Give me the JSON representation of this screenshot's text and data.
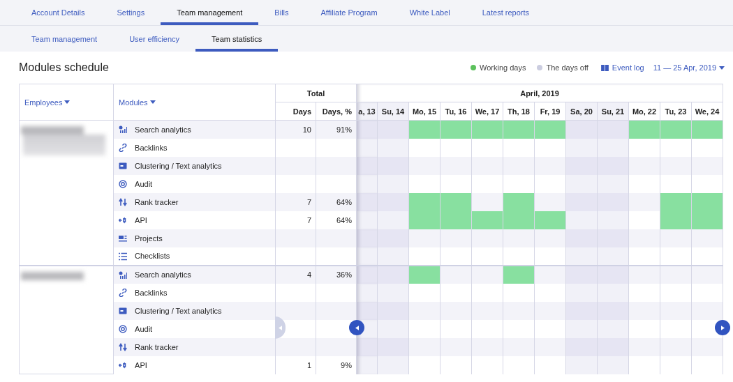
{
  "tabs": [
    {
      "label": "Account Details",
      "selected": false
    },
    {
      "label": "Settings",
      "selected": false
    },
    {
      "label": "Team management",
      "selected": true
    },
    {
      "label": "Bills",
      "selected": false
    },
    {
      "label": "Affiliate Program",
      "selected": false
    },
    {
      "label": "White Label",
      "selected": false
    },
    {
      "label": "Latest reports",
      "selected": false
    }
  ],
  "subtabs": [
    {
      "label": "Team management",
      "selected": false
    },
    {
      "label": "User efficiency",
      "selected": false
    },
    {
      "label": "Team statistics",
      "selected": true
    }
  ],
  "title": "Modules schedule",
  "legend": [
    {
      "label": "Working days",
      "color": "#5cc15c"
    },
    {
      "label": "The days off",
      "color": "#cbcde0"
    }
  ],
  "event_log": "Event log",
  "date_range": "11 — 25 Apr, 2019",
  "table": {
    "employees_header": "Employees",
    "modules_header": "Modules",
    "total_header": "Total",
    "days_header": "Days",
    "pct_header": "Days, %",
    "month": "April, 2019",
    "days": [
      {
        "label": "a, 13",
        "off": true
      },
      {
        "label": "Su, 14",
        "off": true
      },
      {
        "label": "Mo, 15",
        "off": false
      },
      {
        "label": "Tu, 16",
        "off": false
      },
      {
        "label": "We, 17",
        "off": false
      },
      {
        "label": "Th, 18",
        "off": false
      },
      {
        "label": "Fr, 19",
        "off": false
      },
      {
        "label": "Sa, 20",
        "off": true
      },
      {
        "label": "Su, 21",
        "off": true
      },
      {
        "label": "Mo, 22",
        "off": false
      },
      {
        "label": "Tu, 23",
        "off": false
      },
      {
        "label": "We, 24",
        "off": false
      }
    ],
    "employees": [
      {
        "modules": [
          {
            "kind": "search",
            "name": "Search analytics",
            "days": "10",
            "pct": "91%",
            "work": [
              false,
              false,
              true,
              true,
              true,
              true,
              true,
              false,
              false,
              true,
              true,
              true
            ]
          },
          {
            "kind": "link",
            "name": "Backlinks",
            "work": [
              false,
              false,
              false,
              false,
              false,
              false,
              false,
              false,
              false,
              false,
              false,
              false
            ]
          },
          {
            "kind": "cluster",
            "name": "Clustering / Text analytics",
            "work": [
              false,
              false,
              false,
              false,
              false,
              false,
              false,
              false,
              false,
              false,
              false,
              false
            ]
          },
          {
            "kind": "audit",
            "name": "Audit",
            "work": [
              false,
              false,
              false,
              false,
              false,
              false,
              false,
              false,
              false,
              false,
              false,
              false
            ]
          },
          {
            "kind": "rank",
            "name": "Rank tracker",
            "days": "7",
            "pct": "64%",
            "work": [
              false,
              false,
              true,
              true,
              false,
              true,
              false,
              false,
              false,
              false,
              true,
              true
            ]
          },
          {
            "kind": "api",
            "name": "API",
            "days": "7",
            "pct": "64%",
            "work": [
              false,
              false,
              true,
              true,
              true,
              true,
              true,
              false,
              false,
              false,
              true,
              true
            ]
          },
          {
            "kind": "projects",
            "name": "Projects",
            "work": [
              false,
              false,
              false,
              false,
              false,
              false,
              false,
              false,
              false,
              false,
              false,
              false
            ]
          },
          {
            "kind": "checklist",
            "name": "Checklists",
            "work": [
              false,
              false,
              false,
              false,
              false,
              false,
              false,
              false,
              false,
              false,
              false,
              false
            ]
          }
        ]
      },
      {
        "modules": [
          {
            "kind": "search",
            "name": "Search analytics",
            "days": "4",
            "pct": "36%",
            "work": [
              false,
              false,
              true,
              false,
              false,
              true,
              false,
              false,
              false,
              false,
              false,
              false
            ]
          },
          {
            "kind": "link",
            "name": "Backlinks",
            "work": [
              false,
              false,
              false,
              false,
              false,
              false,
              false,
              false,
              false,
              false,
              false,
              false
            ]
          },
          {
            "kind": "cluster",
            "name": "Clustering / Text analytics",
            "work": [
              false,
              false,
              false,
              false,
              false,
              false,
              false,
              false,
              false,
              false,
              false,
              false
            ]
          },
          {
            "kind": "audit",
            "name": "Audit",
            "work": [
              false,
              false,
              false,
              false,
              false,
              false,
              false,
              false,
              false,
              false,
              false,
              false
            ]
          },
          {
            "kind": "rank",
            "name": "Rank tracker",
            "work": [
              false,
              false,
              false,
              false,
              false,
              false,
              false,
              false,
              false,
              false,
              false,
              false
            ]
          },
          {
            "kind": "api",
            "name": "API",
            "days": "1",
            "pct": "9%",
            "work": [
              false,
              false,
              false,
              false,
              false,
              false,
              false,
              false,
              false,
              false,
              false,
              false
            ]
          }
        ]
      }
    ]
  }
}
